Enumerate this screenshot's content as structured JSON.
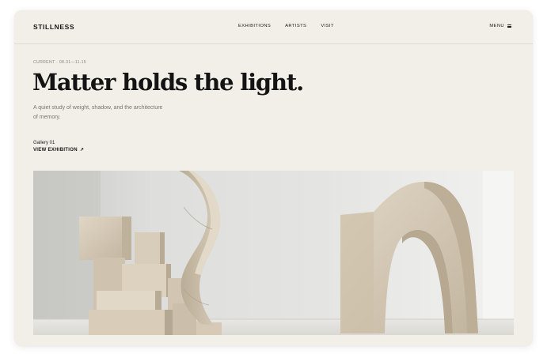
{
  "header": {
    "brand": "STILLNESS",
    "nav": [
      "EXHIBITIONS",
      "ARTISTS",
      "VISIT"
    ],
    "menu_label": "MENU",
    "menu_icon": "hamburger-icon"
  },
  "hero_text": {
    "current": "CURRENT · 08.31—11.15",
    "headline": "Matter holds the light.",
    "description": "A quiet study of weight, shadow, and the architecture of memory.",
    "gallery": "Gallery 01",
    "view_label": "VIEW EXHIBITION",
    "view_icon": "arrow-up-right-icon"
  },
  "colors": {
    "page_background": "#f2efe8",
    "text": "#141414",
    "muted": "#7a766d",
    "stone": "#d3c7b3"
  }
}
